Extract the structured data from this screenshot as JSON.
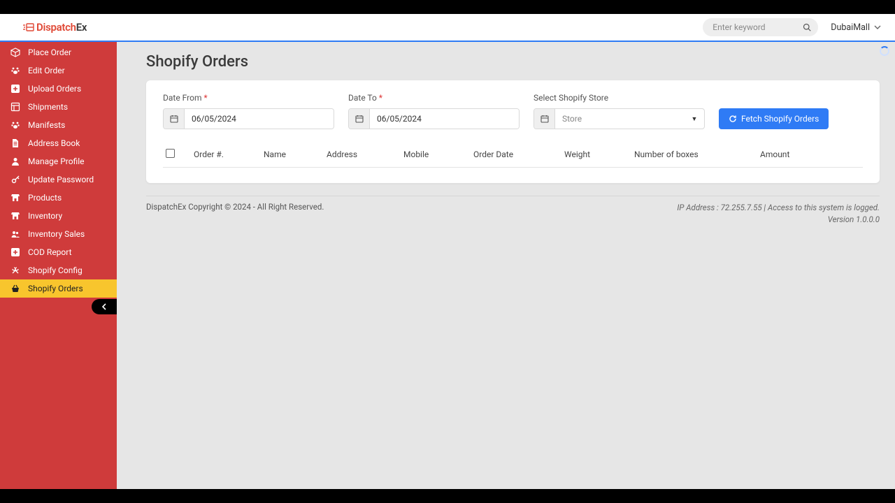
{
  "brand": {
    "name_prefix": "Dispatch",
    "name_suffix": "Ex"
  },
  "search": {
    "placeholder": "Enter keyword"
  },
  "user": {
    "name": "DubaiMall"
  },
  "sidebar": {
    "items": [
      {
        "label": "Place Order",
        "icon": "cube-icon"
      },
      {
        "label": "Edit Order",
        "icon": "paw-icon"
      },
      {
        "label": "Upload Orders",
        "icon": "plus-icon"
      },
      {
        "label": "Shipments",
        "icon": "layout-icon"
      },
      {
        "label": "Manifests",
        "icon": "paw-icon"
      },
      {
        "label": "Address Book",
        "icon": "file-icon"
      },
      {
        "label": "Manage Profile",
        "icon": "user-icon"
      },
      {
        "label": "Update Password",
        "icon": "key-icon"
      },
      {
        "label": "Products",
        "icon": "store-icon"
      },
      {
        "label": "Inventory",
        "icon": "store-icon"
      },
      {
        "label": "Inventory Sales",
        "icon": "group-icon"
      },
      {
        "label": "COD Report",
        "icon": "plus-icon"
      },
      {
        "label": "Shopify Config",
        "icon": "tools-icon"
      },
      {
        "label": "Shopify Orders",
        "icon": "basket-icon"
      }
    ],
    "active_index": 13
  },
  "page": {
    "title": "Shopify Orders"
  },
  "filters": {
    "date_from": {
      "label": "Date From",
      "value": "06/05/2024",
      "required": true
    },
    "date_to": {
      "label": "Date To",
      "value": "06/05/2024",
      "required": true
    },
    "store": {
      "label": "Select Shopify Store",
      "placeholder": "Store"
    },
    "fetch_label": "Fetch Shopify Orders"
  },
  "table": {
    "headers": {
      "order": "Order #.",
      "name": "Name",
      "address": "Address",
      "mobile": "Mobile",
      "date": "Order Date",
      "weight": "Weight",
      "boxes": "Number of boxes",
      "amount": "Amount"
    }
  },
  "footer": {
    "copyright": "DispatchEx Copyright © 2024 - All Right Reserved.",
    "ip_line": "IP Address : 72.255.7.55 | Access to this system is logged.",
    "version": "Version 1.0.0.0"
  }
}
